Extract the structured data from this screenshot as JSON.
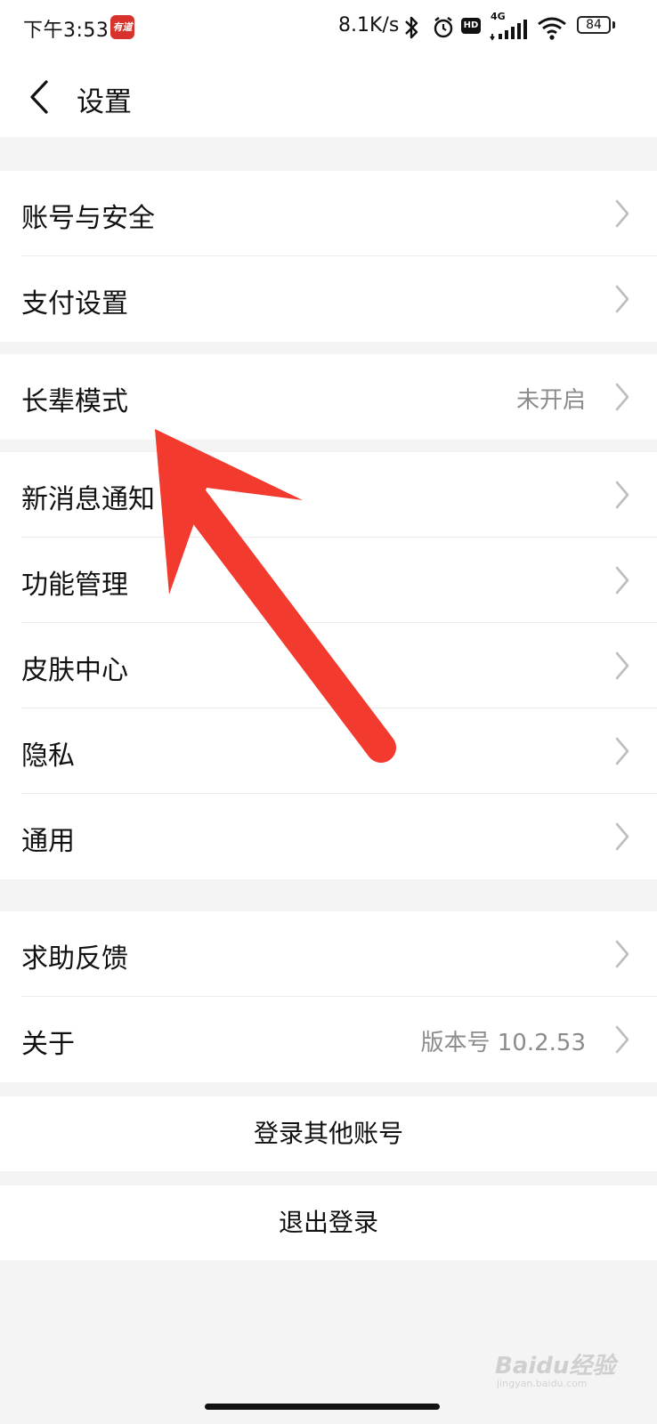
{
  "status_bar": {
    "time": "下午3:53",
    "app_icon_text": "有道",
    "network_speed": "8.1K/s",
    "network_type": "4G",
    "hd_label": "HD",
    "battery_level": "84",
    "icons": [
      "bluetooth-icon",
      "alarm-icon",
      "hd-icon",
      "signal-icon",
      "wifi-icon",
      "battery-icon"
    ]
  },
  "header": {
    "title": "设置",
    "back_icon": "chevron-left-icon"
  },
  "settings": {
    "group1": [
      {
        "label": "账号与安全"
      },
      {
        "label": "支付设置"
      }
    ],
    "group2": [
      {
        "label": "长辈模式",
        "value": "未开启"
      }
    ],
    "group3": [
      {
        "label": "新消息通知"
      },
      {
        "label": "功能管理"
      },
      {
        "label": "皮肤中心"
      },
      {
        "label": "隐私"
      },
      {
        "label": "通用"
      }
    ],
    "group4": [
      {
        "label": "求助反馈"
      },
      {
        "label": "关于",
        "value": "版本号 10.2.53"
      }
    ]
  },
  "actions": {
    "switch_account": "登录其他账号",
    "logout": "退出登录"
  },
  "watermark": {
    "text": "Baidu经验",
    "url": "jingyan.baidu.com"
  },
  "colors": {
    "background": "#f4f4f4",
    "card": "#ffffff",
    "annotation_arrow": "#f23a2f",
    "secondary_text": "#8c8c8c"
  }
}
